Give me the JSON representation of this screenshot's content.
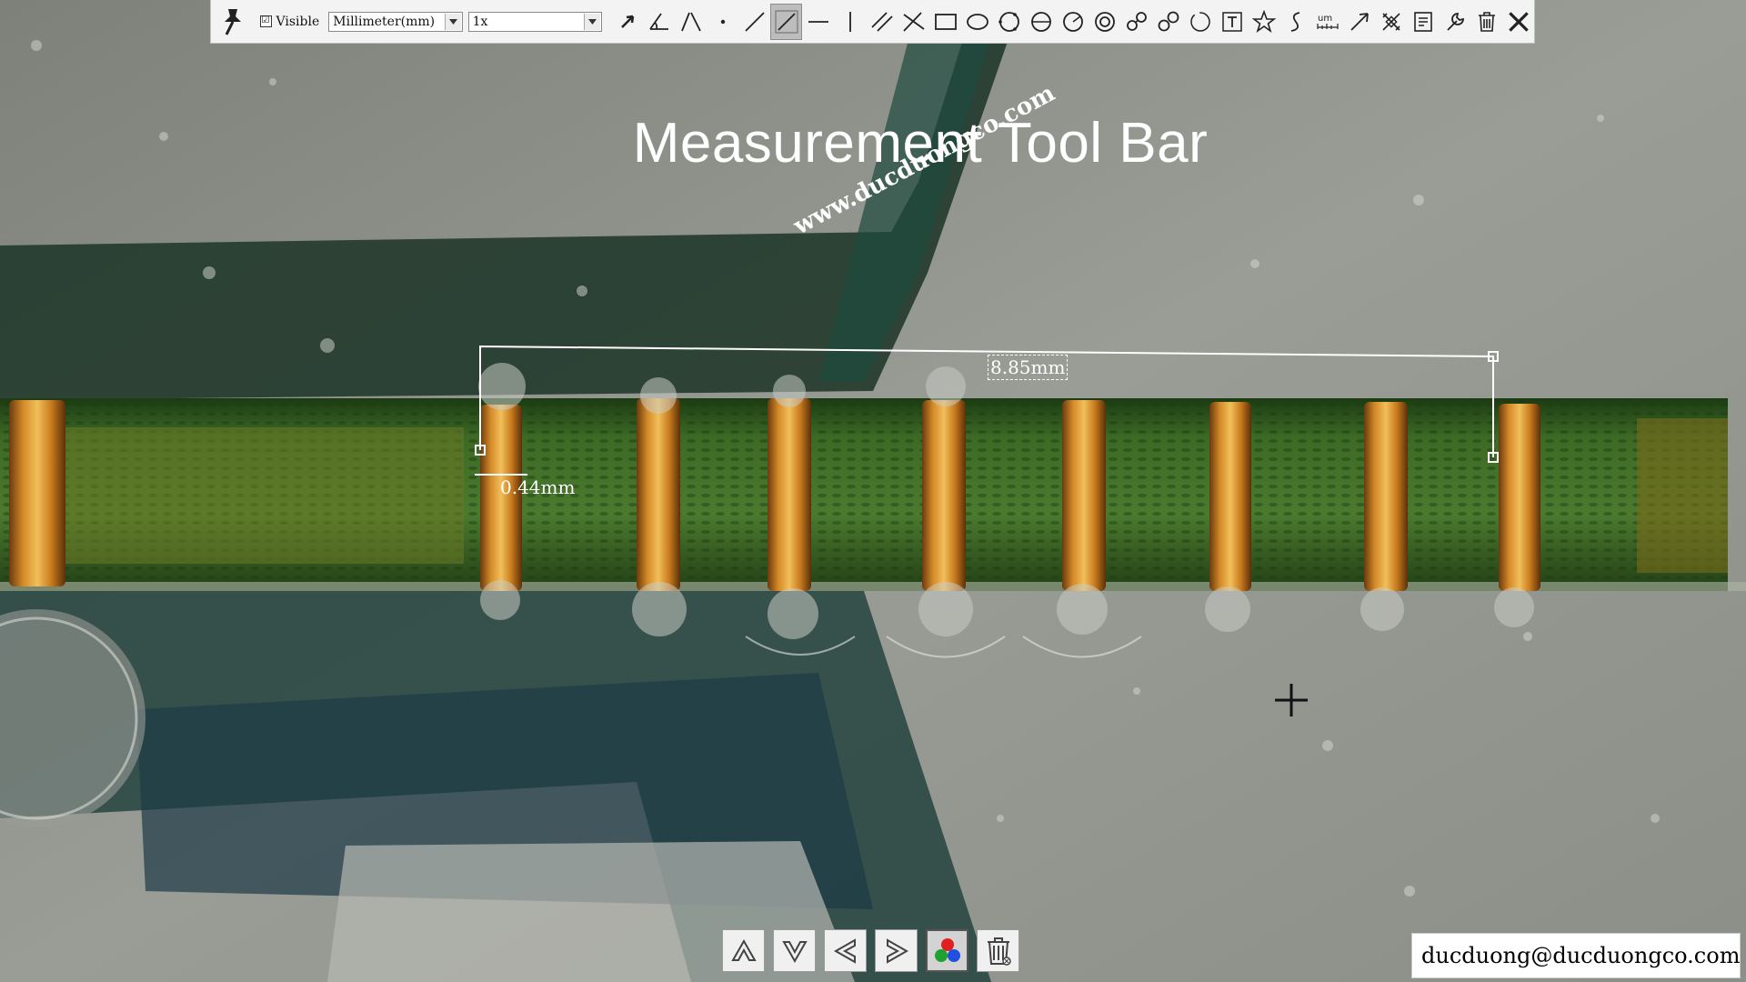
{
  "toolbar": {
    "visible_label": "Visible",
    "visible_checked": true,
    "unit_select": {
      "value": "Millimeter(mm)"
    },
    "zoom_select": {
      "value": "1x"
    },
    "active_tool": "line-measure",
    "tools": [
      "pointer-arrow-icon",
      "angle-icon",
      "two-line-angle-icon",
      "point-icon",
      "line-icon",
      "line-measure-icon",
      "horizontal-line-icon",
      "vertical-line-icon",
      "parallel-lines-icon",
      "intersecting-lines-icon",
      "rectangle-icon",
      "ellipse-icon",
      "circle-three-point-icon",
      "circle-diameter-icon",
      "circle-radius-icon",
      "concentric-circle-icon",
      "two-circle-link-icon",
      "circle-link-icon",
      "arc-icon",
      "text-icon",
      "polygon-star-icon",
      "curve-icon",
      "scale-bar-icon",
      "arrow-icon",
      "calibrate-icon",
      "export-icon",
      "settings-wrench-icon",
      "delete-trash-icon",
      "close-icon"
    ]
  },
  "overlay": {
    "title": "Measurement Tool Bar",
    "watermark": "www.ducduongco.com"
  },
  "measurements": [
    {
      "label": "8.85mm",
      "type": "distance"
    },
    {
      "label": "0.44mm",
      "type": "width"
    }
  ],
  "bottom_bar": {
    "buttons": [
      "move-up-icon",
      "move-down-icon",
      "move-left-icon",
      "move-right-icon",
      "color-icon",
      "delete-all-icon"
    ],
    "active": "color-icon"
  },
  "contact": {
    "email": "ducduong@ducduongco.com"
  },
  "colors": {
    "pcb_green": "#2e5a1e",
    "pad_copper": "#c8821f",
    "background_gray": "#8a8c86",
    "measure_line": "#ffffff"
  }
}
